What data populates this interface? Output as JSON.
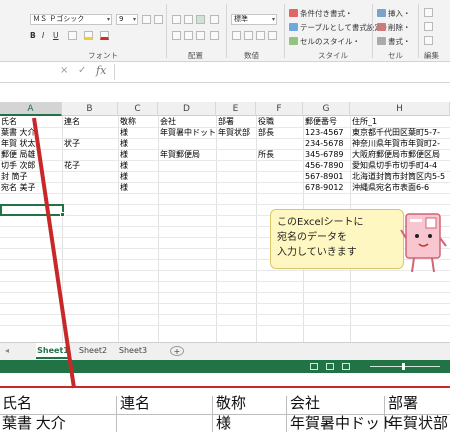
{
  "ribbon": {
    "font_name": "ＭＳ Ｐゴシック",
    "font_size": "9",
    "number_format": "標準",
    "groups": {
      "font": "フォント",
      "alignment": "配置",
      "number": "数値",
      "styles": "スタイル",
      "cells": "セル",
      "editing": "編集"
    },
    "styles_items": [
      "条件付き書式・",
      "テーブルとして書式設定・",
      "セルのスタイル・"
    ],
    "cells_items": [
      "挿入・",
      "削除・",
      "書式・"
    ],
    "bold": "B",
    "italic": "I",
    "underline": "U"
  },
  "formula_bar": {
    "cancel": "×",
    "enter": "✓",
    "fx": "fx"
  },
  "grid": {
    "columns": [
      "A",
      "B",
      "C",
      "D",
      "E",
      "F",
      "G",
      "H"
    ],
    "rows": [
      [
        "氏名",
        "連名",
        "敬称",
        "会社",
        "部署",
        "役職",
        "郵便番号",
        "住所_1"
      ],
      [
        "葉書 大介",
        "",
        "様",
        "年賀暑中ドット",
        "年賀状部",
        "部長",
        "123-4567",
        "東京都千代田区葉町5-7-"
      ],
      [
        "年賀 状太",
        "状子",
        "様",
        "",
        "",
        "",
        "234-5678",
        "神奈川県年賀市年賀町2-"
      ],
      [
        "郵便 局雄",
        "",
        "様",
        "年賀郵便局",
        "",
        "所長",
        "345-6789",
        "大阪府郵便局市郵便区局"
      ],
      [
        "切手 次郎",
        "花子",
        "様",
        "",
        "",
        "",
        "456-7890",
        "愛知県切手市切手町4-4"
      ],
      [
        "封 筒子",
        "",
        "様",
        "",
        "",
        "",
        "567-8901",
        "北海道封筒市封筒区内5-5"
      ],
      [
        "宛名 美子",
        "",
        "様",
        "",
        "",
        "",
        "678-9012",
        "沖縄県宛名市表面6-6"
      ]
    ]
  },
  "sheets": [
    "Sheet1",
    "Sheet2",
    "Sheet3"
  ],
  "add_sheet": "+",
  "callout": {
    "lines": [
      "このExcelシートに",
      "宛名のデータを",
      "入力していきます"
    ]
  },
  "zoom": {
    "headers": [
      "氏名",
      "連名",
      "敬称",
      "会社",
      "部署"
    ],
    "row1": [
      "葉書 大介",
      "",
      "様",
      "年賀暑中ドット",
      "年賀状部"
    ]
  },
  "colors": {
    "excel_green": "#217346",
    "annotation_red": "#c8282a",
    "callout_bg": "#fff7c2"
  }
}
